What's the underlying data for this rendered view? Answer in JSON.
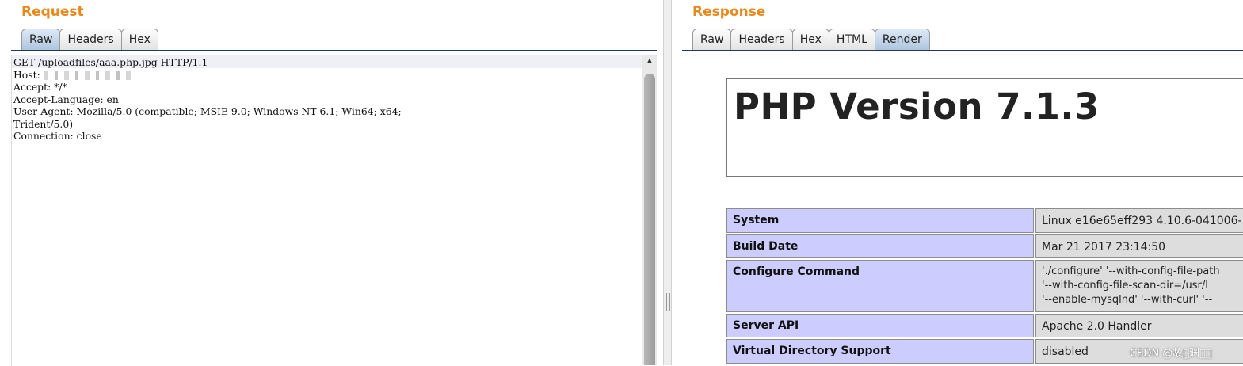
{
  "request": {
    "title": "Request",
    "tabs": [
      {
        "label": "Raw",
        "active": true
      },
      {
        "label": "Headers",
        "active": false
      },
      {
        "label": "Hex",
        "active": false
      }
    ],
    "lines": [
      "GET /uploadfiles/aaa.php.jpg HTTP/1.1",
      "Host: ",
      "Accept: */*",
      "Accept-Language: en",
      "User-Agent: Mozilla/5.0 (compatible; MSIE 9.0; Windows NT 6.1; Win64; x64;",
      "Trident/5.0)",
      "Connection: close"
    ]
  },
  "response": {
    "title": "Response",
    "tabs": [
      {
        "label": "Raw",
        "active": false
      },
      {
        "label": "Headers",
        "active": false
      },
      {
        "label": "Hex",
        "active": false
      },
      {
        "label": "HTML",
        "active": false
      },
      {
        "label": "Render",
        "active": true
      }
    ],
    "render": {
      "php_title": "PHP Version 7.1.3",
      "rows": [
        {
          "key": "System",
          "value": "Linux e16e65eff293 4.10.6-041006-"
        },
        {
          "key": "Build Date",
          "value": "Mar 21 2017 23:14:50"
        },
        {
          "key": "Configure Command",
          "value": "'./configure' '--with-config-file-path\n'--with-config-file-scan-dir=/usr/l\n'--enable-mysqlnd' '--with-curl' '--"
        },
        {
          "key": "Server API",
          "value": "Apache 2.0 Handler"
        },
        {
          "key": "Virtual Directory Support",
          "value": "disabled"
        }
      ]
    }
  },
  "watermark": "CSDN @故\u0000渊\u0000\u0000"
}
